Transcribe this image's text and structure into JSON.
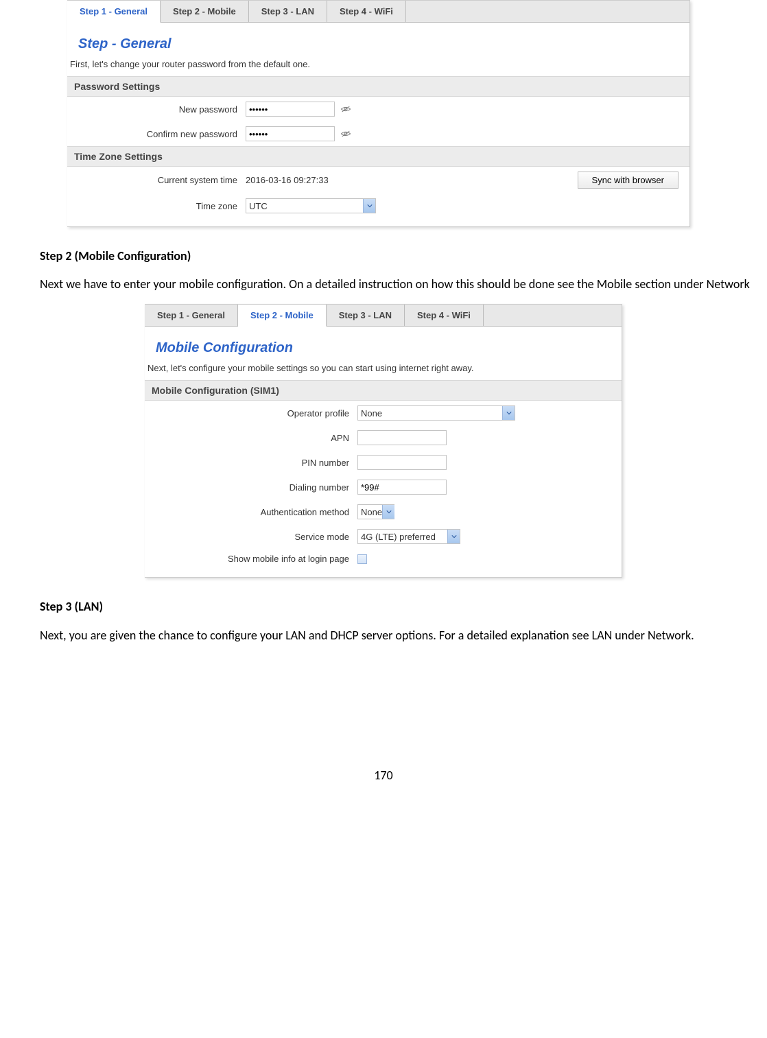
{
  "panel1": {
    "tabs": [
      "Step 1 - General",
      "Step 2 - Mobile",
      "Step 3 - LAN",
      "Step 4 - WiFi"
    ],
    "title": "Step - General",
    "desc": "First, let's change your router password from the default one.",
    "pw_section": "Password Settings",
    "new_pw_label": "New password",
    "new_pw_value": "••••••",
    "confirm_pw_label": "Confirm new password",
    "confirm_pw_value": "••••••",
    "tz_section": "Time Zone Settings",
    "systime_label": "Current system time",
    "systime_value": "2016-03-16 09:27:33",
    "sync_btn": "Sync with browser",
    "tz_label": "Time zone",
    "tz_value": "UTC"
  },
  "doc": {
    "h2": "Step 2 (Mobile Configuration)",
    "p2": "Next we have to enter your mobile configuration. On a detailed instruction on how this should be done see the Mobile section under Network",
    "h3": "Step 3 (LAN)",
    "p3": "Next, you are given the chance to configure your LAN and DHCP server options. For a detailed explanation see LAN under Network.",
    "page": "170"
  },
  "panel2": {
    "tabs": [
      "Step 1 - General",
      "Step 2 - Mobile",
      "Step 3 - LAN",
      "Step 4 - WiFi"
    ],
    "title": "Mobile Configuration",
    "desc": "Next, let's configure your mobile settings so you can start using internet right away.",
    "section": "Mobile Configuration (SIM1)",
    "op_label": "Operator profile",
    "op_value": "None",
    "apn_label": "APN",
    "apn_value": "",
    "pin_label": "PIN number",
    "pin_value": "",
    "dial_label": "Dialing number",
    "dial_value": "*99#",
    "auth_label": "Authentication method",
    "auth_value": "None",
    "svc_label": "Service mode",
    "svc_value": "4G (LTE) preferred",
    "show_label": "Show mobile info at login page"
  }
}
